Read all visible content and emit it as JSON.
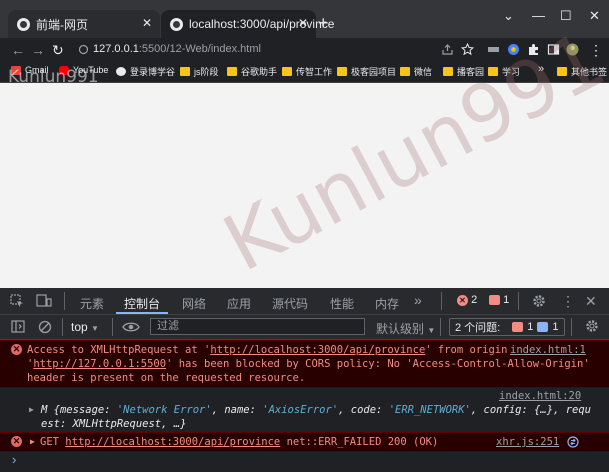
{
  "browser": {
    "tabs": [
      {
        "title": "前端-网页",
        "active": false
      },
      {
        "title": "localhost:3000/api/province",
        "active": true
      }
    ],
    "new_tab": "+",
    "window_controls": [
      "⌄",
      "—",
      "☐",
      "✕"
    ],
    "url_host": "127.0.0.1",
    "url_path": ":5500/12-Web/index.html",
    "bookmarks": [
      "Gmail",
      "YouTube",
      "登录博学谷",
      "js阶段",
      "谷歌助手",
      "传智工作",
      "极客园项目",
      "微信",
      "播客园",
      "学习"
    ],
    "bookmarks_more": "»",
    "other_bookmarks": "其他书签"
  },
  "watermark": {
    "top": "Kunlun991",
    "center": "Kunlun991"
  },
  "devtools": {
    "tabs": [
      "元素",
      "控制台",
      "网络",
      "应用",
      "源代码",
      "性能",
      "内存"
    ],
    "more_tabs": "»",
    "error_count": "2",
    "message_count": "1",
    "context": "top",
    "filter_placeholder": "过滤",
    "level": "默认级别",
    "issues_label": "2 个问题:",
    "issues_err": "1",
    "issues_info": "1"
  },
  "console": {
    "row1": {
      "line1_a": "Access to XMLHttpRequest at '",
      "line1_link": "http://localhost:3000/api/province",
      "line1_b": "' from origin",
      "source": "index.html:1",
      "line2_a": "'",
      "line2_link": "http://127.0.0.1:5500",
      "line2_b": "' has been blocked by CORS policy: No 'Access-Control-Allow-Origin'",
      "line3": "header is present on the requested resource."
    },
    "row2": {
      "source": "index.html:20",
      "prefix": "M {message: ",
      "message_val": "'Network Error'",
      "name_key": ", name: ",
      "name_val": "'AxiosError'",
      "code_key": ", code: ",
      "code_val": "'ERR_NETWORK'",
      "config_key": ", config: {…}, requ",
      "line2": "est: XMLHttpRequest, …}"
    },
    "row3": {
      "method": "GET",
      "link": "http://localhost:3000/api/province",
      "status": "net::ERR_FAILED 200 (OK)",
      "source": "xhr.js:251"
    },
    "prompt": "›"
  }
}
